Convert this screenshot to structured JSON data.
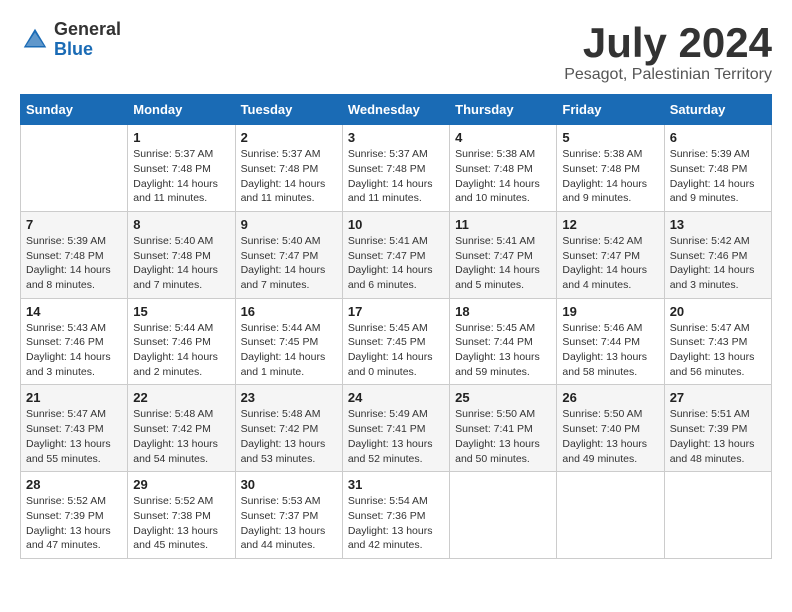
{
  "logo": {
    "general": "General",
    "blue": "Blue"
  },
  "title": "July 2024",
  "location": "Pesagot, Palestinian Territory",
  "weekdays": [
    "Sunday",
    "Monday",
    "Tuesday",
    "Wednesday",
    "Thursday",
    "Friday",
    "Saturday"
  ],
  "weeks": [
    [
      {
        "day": "",
        "info": ""
      },
      {
        "day": "1",
        "info": "Sunrise: 5:37 AM\nSunset: 7:48 PM\nDaylight: 14 hours\nand 11 minutes."
      },
      {
        "day": "2",
        "info": "Sunrise: 5:37 AM\nSunset: 7:48 PM\nDaylight: 14 hours\nand 11 minutes."
      },
      {
        "day": "3",
        "info": "Sunrise: 5:37 AM\nSunset: 7:48 PM\nDaylight: 14 hours\nand 11 minutes."
      },
      {
        "day": "4",
        "info": "Sunrise: 5:38 AM\nSunset: 7:48 PM\nDaylight: 14 hours\nand 10 minutes."
      },
      {
        "day": "5",
        "info": "Sunrise: 5:38 AM\nSunset: 7:48 PM\nDaylight: 14 hours\nand 9 minutes."
      },
      {
        "day": "6",
        "info": "Sunrise: 5:39 AM\nSunset: 7:48 PM\nDaylight: 14 hours\nand 9 minutes."
      }
    ],
    [
      {
        "day": "7",
        "info": "Sunrise: 5:39 AM\nSunset: 7:48 PM\nDaylight: 14 hours\nand 8 minutes."
      },
      {
        "day": "8",
        "info": "Sunrise: 5:40 AM\nSunset: 7:48 PM\nDaylight: 14 hours\nand 7 minutes."
      },
      {
        "day": "9",
        "info": "Sunrise: 5:40 AM\nSunset: 7:47 PM\nDaylight: 14 hours\nand 7 minutes."
      },
      {
        "day": "10",
        "info": "Sunrise: 5:41 AM\nSunset: 7:47 PM\nDaylight: 14 hours\nand 6 minutes."
      },
      {
        "day": "11",
        "info": "Sunrise: 5:41 AM\nSunset: 7:47 PM\nDaylight: 14 hours\nand 5 minutes."
      },
      {
        "day": "12",
        "info": "Sunrise: 5:42 AM\nSunset: 7:47 PM\nDaylight: 14 hours\nand 4 minutes."
      },
      {
        "day": "13",
        "info": "Sunrise: 5:42 AM\nSunset: 7:46 PM\nDaylight: 14 hours\nand 3 minutes."
      }
    ],
    [
      {
        "day": "14",
        "info": "Sunrise: 5:43 AM\nSunset: 7:46 PM\nDaylight: 14 hours\nand 3 minutes."
      },
      {
        "day": "15",
        "info": "Sunrise: 5:44 AM\nSunset: 7:46 PM\nDaylight: 14 hours\nand 2 minutes."
      },
      {
        "day": "16",
        "info": "Sunrise: 5:44 AM\nSunset: 7:45 PM\nDaylight: 14 hours\nand 1 minute."
      },
      {
        "day": "17",
        "info": "Sunrise: 5:45 AM\nSunset: 7:45 PM\nDaylight: 14 hours\nand 0 minutes."
      },
      {
        "day": "18",
        "info": "Sunrise: 5:45 AM\nSunset: 7:44 PM\nDaylight: 13 hours\nand 59 minutes."
      },
      {
        "day": "19",
        "info": "Sunrise: 5:46 AM\nSunset: 7:44 PM\nDaylight: 13 hours\nand 58 minutes."
      },
      {
        "day": "20",
        "info": "Sunrise: 5:47 AM\nSunset: 7:43 PM\nDaylight: 13 hours\nand 56 minutes."
      }
    ],
    [
      {
        "day": "21",
        "info": "Sunrise: 5:47 AM\nSunset: 7:43 PM\nDaylight: 13 hours\nand 55 minutes."
      },
      {
        "day": "22",
        "info": "Sunrise: 5:48 AM\nSunset: 7:42 PM\nDaylight: 13 hours\nand 54 minutes."
      },
      {
        "day": "23",
        "info": "Sunrise: 5:48 AM\nSunset: 7:42 PM\nDaylight: 13 hours\nand 53 minutes."
      },
      {
        "day": "24",
        "info": "Sunrise: 5:49 AM\nSunset: 7:41 PM\nDaylight: 13 hours\nand 52 minutes."
      },
      {
        "day": "25",
        "info": "Sunrise: 5:50 AM\nSunset: 7:41 PM\nDaylight: 13 hours\nand 50 minutes."
      },
      {
        "day": "26",
        "info": "Sunrise: 5:50 AM\nSunset: 7:40 PM\nDaylight: 13 hours\nand 49 minutes."
      },
      {
        "day": "27",
        "info": "Sunrise: 5:51 AM\nSunset: 7:39 PM\nDaylight: 13 hours\nand 48 minutes."
      }
    ],
    [
      {
        "day": "28",
        "info": "Sunrise: 5:52 AM\nSunset: 7:39 PM\nDaylight: 13 hours\nand 47 minutes."
      },
      {
        "day": "29",
        "info": "Sunrise: 5:52 AM\nSunset: 7:38 PM\nDaylight: 13 hours\nand 45 minutes."
      },
      {
        "day": "30",
        "info": "Sunrise: 5:53 AM\nSunset: 7:37 PM\nDaylight: 13 hours\nand 44 minutes."
      },
      {
        "day": "31",
        "info": "Sunrise: 5:54 AM\nSunset: 7:36 PM\nDaylight: 13 hours\nand 42 minutes."
      },
      {
        "day": "",
        "info": ""
      },
      {
        "day": "",
        "info": ""
      },
      {
        "day": "",
        "info": ""
      }
    ]
  ]
}
